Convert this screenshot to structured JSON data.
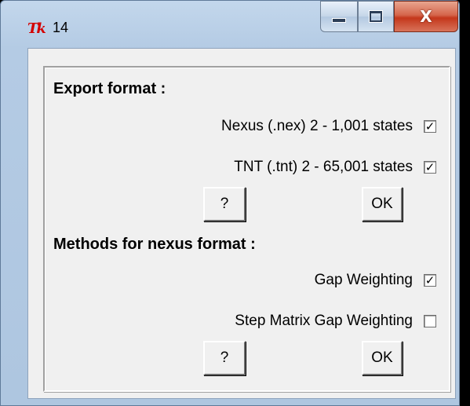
{
  "window": {
    "title": "14",
    "app_icon": "Tk",
    "controls": {
      "minimize": "minimize-icon",
      "maximize": "maximize-icon",
      "close": "X"
    }
  },
  "export_section": {
    "heading": "Export format :",
    "options": [
      {
        "label": "Nexus (.nex) 2 - 1,001 states",
        "checked": true,
        "mark": "✓"
      },
      {
        "label": "TNT (.tnt) 2 - 65,001 states",
        "checked": true,
        "mark": "✓"
      }
    ],
    "help_label": "?",
    "ok_label": "OK"
  },
  "methods_section": {
    "heading": "Methods for nexus format :",
    "options": [
      {
        "label": "Gap Weighting",
        "checked": true,
        "mark": "✓"
      },
      {
        "label": "Step Matrix Gap Weighting",
        "checked": false,
        "mark": ""
      }
    ],
    "help_label": "?",
    "ok_label": "OK"
  }
}
